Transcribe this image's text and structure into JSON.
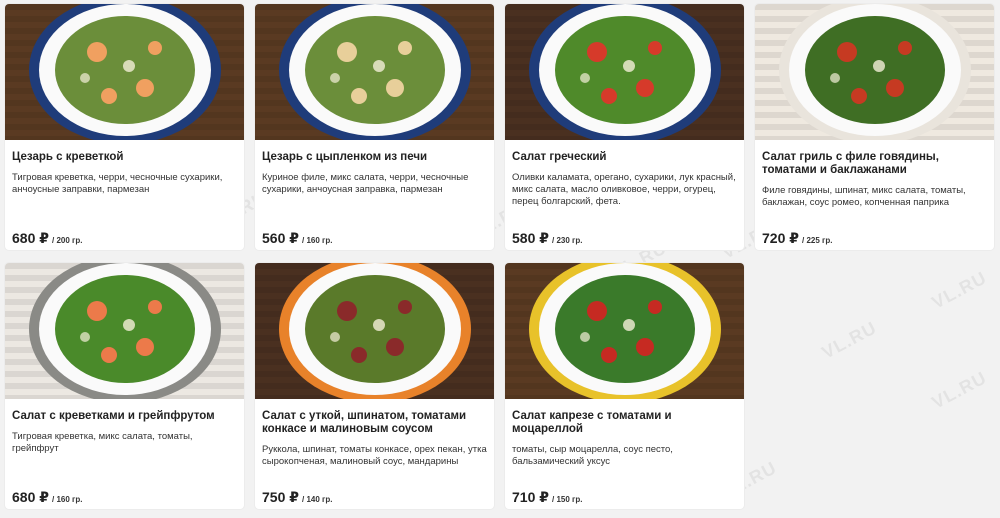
{
  "menu": {
    "items": [
      {
        "title": "Цезарь с креветкой",
        "description": "Тигровая креветка, черри, чесночные сухарики, анчоусные заправки, пармезан",
        "price": "680 ₽",
        "weight": "/ 200 гр.",
        "bowl": "#1f3c7a",
        "bg": "#5a3a22",
        "food": "#6b8e3a",
        "accent": "#f0a060"
      },
      {
        "title": "Цезарь с цыпленком из печи",
        "description": "Куриное филе, микс салата, черри, чесночные сухарики, анчоусная заправка, пармезан",
        "price": "560 ₽",
        "weight": "/ 160 гр.",
        "bowl": "#1f3c7a",
        "bg": "#5a3a22",
        "food": "#6b8e3a",
        "accent": "#e8cf9a"
      },
      {
        "title": "Салат греческий",
        "description": "Оливки каламата, орегано, сухарики, лук красный, микс салата, масло оливковое, черри, огурец, перец болгарский, фета.",
        "price": "580 ₽",
        "weight": "/ 230 гр.",
        "bowl": "#1f3c7a",
        "bg": "#4a3020",
        "food": "#4f8a2a",
        "accent": "#d63a2a"
      },
      {
        "title": "Салат гриль с филе говядины, томатами и баклажанами",
        "description": "Филе говядины, шпинат, микс салата, томаты, баклажан, соус ромео, копченная паприка",
        "price": "720 ₽",
        "weight": "/ 225 гр.",
        "bowl": "#e9e4dc",
        "bg": "#efe9e0",
        "food": "#3f6e24",
        "accent": "#c63a22"
      },
      {
        "title": "Салат с креветками и грейпфрутом",
        "description": "Тигровая креветка, микс салата, томаты, грейпфрут",
        "price": "680 ₽",
        "weight": "/ 160 гр.",
        "bowl": "#8a8a86",
        "bg": "#ece8e2",
        "food": "#4a8a2a",
        "accent": "#ec7a4a"
      },
      {
        "title": "Салат с уткой, шпинатом, томатами конкасе и малиновым соусом",
        "description": "Руккола, шпинат, томаты конкасе, орех пекан, утка сырокопченая, малиновый соус, мандарины",
        "price": "750 ₽",
        "weight": "/ 140 гр.",
        "bowl": "#e8822a",
        "bg": "#4a3020",
        "food": "#5a7a2a",
        "accent": "#8a2a2a"
      },
      {
        "title": "Салат капрезе с томатами и моцареллой",
        "description": "томаты, сыр моцарелла, соус песто, бальзамический уксус",
        "price": "710 ₽",
        "weight": "/ 150 гр.",
        "bowl": "#e8c22a",
        "bg": "#5a3a22",
        "food": "#3a7a2a",
        "accent": "#c62a22"
      }
    ]
  },
  "watermark": "VL.RU"
}
